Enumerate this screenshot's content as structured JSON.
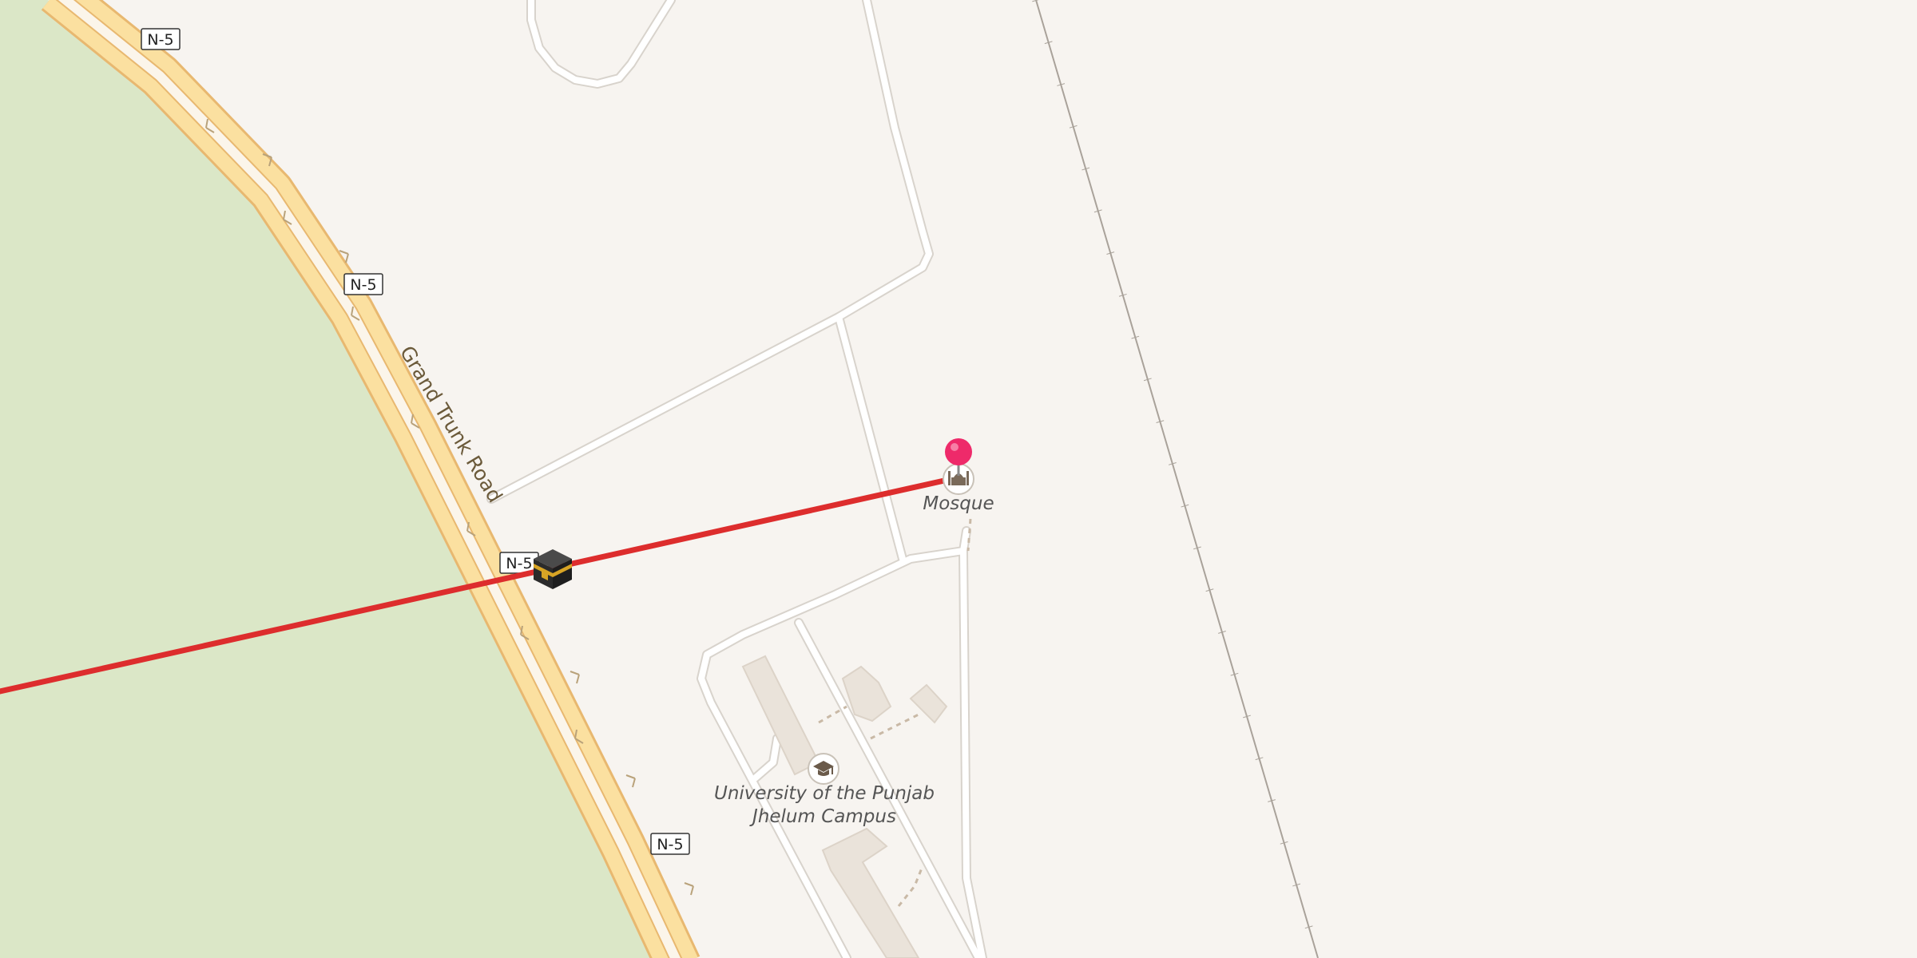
{
  "map": {
    "roads": {
      "primary_name": "Grand Trunk Road",
      "route_ref": "N-5"
    },
    "pois": {
      "mosque": "Mosque",
      "university_line1": "University of the Punjab",
      "university_line2": "Jhelum Campus"
    },
    "colors": {
      "land": "#f7f4f0",
      "park": "#dbe7c7",
      "trunk_fill": "#fbe0a0",
      "trunk_casing": "#e8b870",
      "minor_road": "#ffffff",
      "minor_casing": "#d8d3cc",
      "railway": "#a9a29a",
      "building": "#eae3da",
      "qibla_line": "#dd2d2d",
      "pin": "#ee2a6a"
    },
    "icons": {
      "qibla_marker": "kaaba-icon",
      "location_pin": "map-pin-icon",
      "mosque": "mosque-icon",
      "university": "graduation-cap-icon"
    }
  }
}
